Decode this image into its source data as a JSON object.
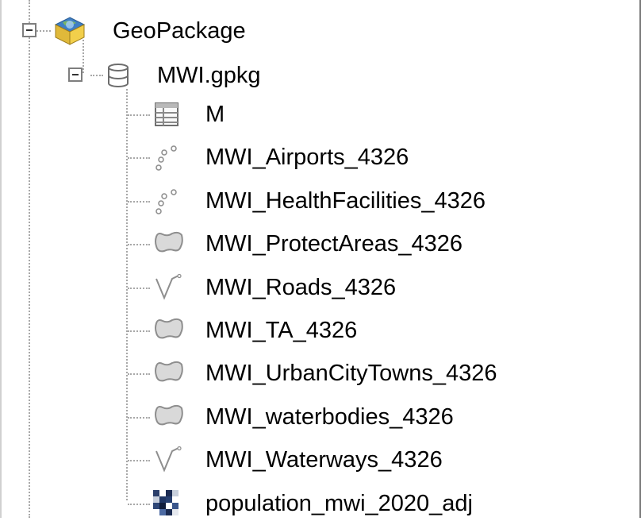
{
  "tree": {
    "root": {
      "label": "GeoPackage",
      "icon": "geopackage-icon",
      "expanded": true
    },
    "file": {
      "label": "MWI.gpkg",
      "icon": "database-icon",
      "expanded": true
    },
    "layers": [
      {
        "label": "M",
        "icon": "table-icon"
      },
      {
        "label": "MWI_Airports_4326",
        "icon": "point-layer-icon"
      },
      {
        "label": "MWI_HealthFacilities_4326",
        "icon": "point-layer-icon"
      },
      {
        "label": "MWI_ProtectAreas_4326",
        "icon": "polygon-layer-icon"
      },
      {
        "label": "MWI_Roads_4326",
        "icon": "line-layer-icon"
      },
      {
        "label": "MWI_TA_4326",
        "icon": "polygon-layer-icon"
      },
      {
        "label": "MWI_UrbanCityTowns_4326",
        "icon": "polygon-layer-icon"
      },
      {
        "label": "MWI_waterbodies_4326",
        "icon": "polygon-layer-icon"
      },
      {
        "label": "MWI_Waterways_4326",
        "icon": "line-layer-icon"
      },
      {
        "label": "population_mwi_2020_adj",
        "icon": "raster-layer-icon"
      }
    ]
  }
}
